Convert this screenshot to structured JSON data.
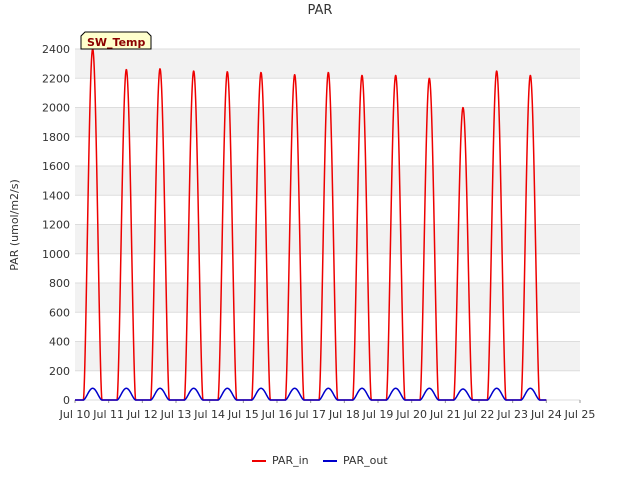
{
  "chart_data": {
    "type": "line",
    "title": "PAR",
    "ylabel": "PAR (umol/m2/s)",
    "xlabel": "",
    "ylim": [
      0,
      2400
    ],
    "yticks": [
      0,
      200,
      400,
      600,
      800,
      1000,
      1200,
      1400,
      1600,
      1800,
      2000,
      2200,
      2400
    ],
    "xlim": [
      "2024-07-10",
      "2024-07-25"
    ],
    "xtick_labels": [
      "Jul 10",
      "Jul 11",
      "Jul 12",
      "Jul 13",
      "Jul 14",
      "Jul 15",
      "Jul 16",
      "Jul 17",
      "Jul 18",
      "Jul 19",
      "Jul 20",
      "Jul 21",
      "Jul 22",
      "Jul 23",
      "Jul 24",
      "Jul 25"
    ],
    "grid": true,
    "legend_position": "bottom-center",
    "badge": "SW_Temp",
    "colors": {
      "PAR_in": "#ee0000",
      "PAR_out": "#0000cc",
      "band": "#f2f2f2",
      "badge_bg": "#ffffcc"
    },
    "series": [
      {
        "name": "PAR_in",
        "daily_peak": [
          [
            "2024-07-10",
            2400
          ],
          [
            "2024-07-11",
            2260
          ],
          [
            "2024-07-12",
            2265
          ],
          [
            "2024-07-13",
            2250
          ],
          [
            "2024-07-14",
            2245
          ],
          [
            "2024-07-15",
            2240
          ],
          [
            "2024-07-16",
            2225
          ],
          [
            "2024-07-17",
            2240
          ],
          [
            "2024-07-18",
            2220
          ],
          [
            "2024-07-19",
            2220
          ],
          [
            "2024-07-20",
            2200
          ],
          [
            "2024-07-21",
            2000
          ],
          [
            "2024-07-22",
            2250
          ],
          [
            "2024-07-23",
            2220
          ]
        ]
      },
      {
        "name": "PAR_out",
        "daily_peak": [
          [
            "2024-07-10",
            80
          ],
          [
            "2024-07-11",
            80
          ],
          [
            "2024-07-12",
            80
          ],
          [
            "2024-07-13",
            80
          ],
          [
            "2024-07-14",
            80
          ],
          [
            "2024-07-15",
            80
          ],
          [
            "2024-07-16",
            80
          ],
          [
            "2024-07-17",
            80
          ],
          [
            "2024-07-18",
            80
          ],
          [
            "2024-07-19",
            80
          ],
          [
            "2024-07-20",
            80
          ],
          [
            "2024-07-21",
            75
          ],
          [
            "2024-07-22",
            80
          ],
          [
            "2024-07-23",
            80
          ]
        ]
      }
    ],
    "data_start": "2024-07-10",
    "data_end": "2024-07-24"
  }
}
